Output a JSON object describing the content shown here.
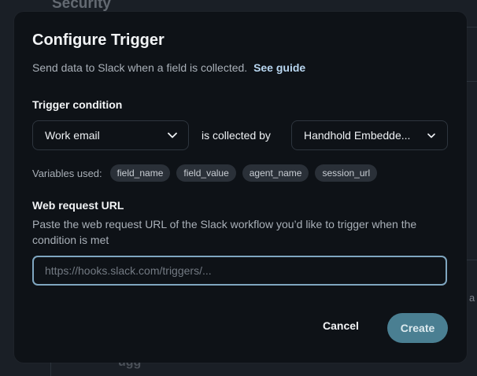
{
  "background": {
    "heading": "Security",
    "fragment": "ugg",
    "edge_text": "a"
  },
  "modal": {
    "title": "Configure Trigger",
    "subtitle": "Send data to Slack when a field is collected.",
    "guide_link": "See guide",
    "trigger": {
      "label": "Trigger condition",
      "field_select": "Work email",
      "connector": "is collected by",
      "agent_select": "Handhold Embedde..."
    },
    "variables": {
      "label": "Variables used:",
      "chips": [
        "field_name",
        "field_value",
        "agent_name",
        "session_url"
      ]
    },
    "webhook": {
      "label": "Web request URL",
      "help": "Paste the web request URL of the Slack workflow you’d like to trigger when the condition is met",
      "placeholder": "https://hooks.slack.com/triggers/...",
      "value": ""
    },
    "actions": {
      "cancel": "Cancel",
      "create": "Create"
    }
  },
  "colors": {
    "accent_button": "#4a7f92",
    "input_focus_border": "#7fa6c0",
    "link": "#b8d6f0"
  }
}
